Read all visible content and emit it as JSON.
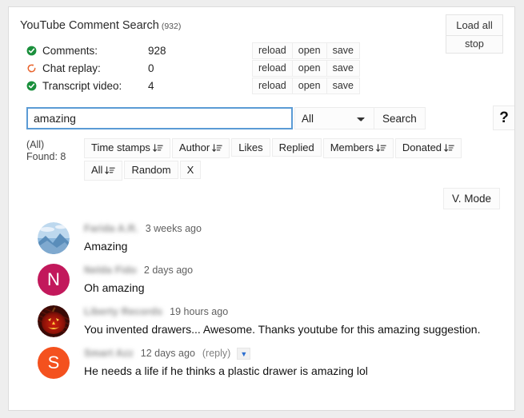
{
  "header": {
    "title": "YouTube Comment Search",
    "count": "(932)",
    "load_all_label": "Load all",
    "stop_label": "stop"
  },
  "status": {
    "action_labels": [
      "reload",
      "open",
      "save"
    ],
    "rows": [
      {
        "icon": "check-circle-icon",
        "icon_color": "#1a8f3c",
        "label": "Comments:",
        "value": "928"
      },
      {
        "icon": "refresh-circle-icon",
        "icon_color": "#e8622a",
        "label": "Chat replay:",
        "value": "0"
      },
      {
        "icon": "check-circle-icon",
        "icon_color": "#1a8f3c",
        "label": "Transcript video:",
        "value": "4"
      }
    ]
  },
  "search": {
    "query": "amazing",
    "placeholder": "",
    "scope_selected": "All",
    "scope_options": [
      "All"
    ],
    "search_label": "Search",
    "help_label": "?"
  },
  "filters": {
    "found_scope": "(All)",
    "found_count": "Found: 8",
    "row1": [
      {
        "label": "Time stamps",
        "sort": true
      },
      {
        "label": "Author",
        "sort": true
      },
      {
        "label": "Likes",
        "sort": false
      },
      {
        "label": "Replied",
        "sort": false
      },
      {
        "label": "Members",
        "sort": true
      },
      {
        "label": "Donated",
        "sort": true
      }
    ],
    "row2": [
      {
        "label": "All",
        "sort": true
      },
      {
        "label": "Random",
        "sort": false
      },
      {
        "label": "X",
        "sort": false
      }
    ],
    "vmode_label": "V. Mode"
  },
  "comments": [
    {
      "author": "Farida A.R.",
      "time": "3 weeks ago",
      "text": "Amazing",
      "avatar": {
        "kind": "photo-landscape",
        "colors": [
          "#bdd8ee",
          "#7fb0d8",
          "#4a7fae"
        ]
      },
      "reply": null,
      "expand": false
    },
    {
      "author": "Nelda Fido",
      "time": "2 days ago",
      "text": "Oh amazing",
      "avatar": {
        "kind": "letter",
        "letter": "N",
        "colors": [
          "#c2185b"
        ]
      },
      "reply": null,
      "expand": false
    },
    {
      "author": "Liberty Records",
      "time": "19 hours ago",
      "text": "You invented drawers... Awesome. Thanks youtube for this amazing suggestion.",
      "avatar": {
        "kind": "photo-pumpkin",
        "colors": [
          "#5c1008",
          "#b3180c",
          "#f0b020"
        ]
      },
      "reply": null,
      "expand": false
    },
    {
      "author": "Smart Azz",
      "time": "12 days ago",
      "text": "He needs a life if he thinks a plastic drawer is amazing lol",
      "avatar": {
        "kind": "letter",
        "letter": "S",
        "colors": [
          "#f4511e"
        ]
      },
      "reply": "(reply)",
      "expand": true,
      "expand_glyph": "▼"
    }
  ]
}
